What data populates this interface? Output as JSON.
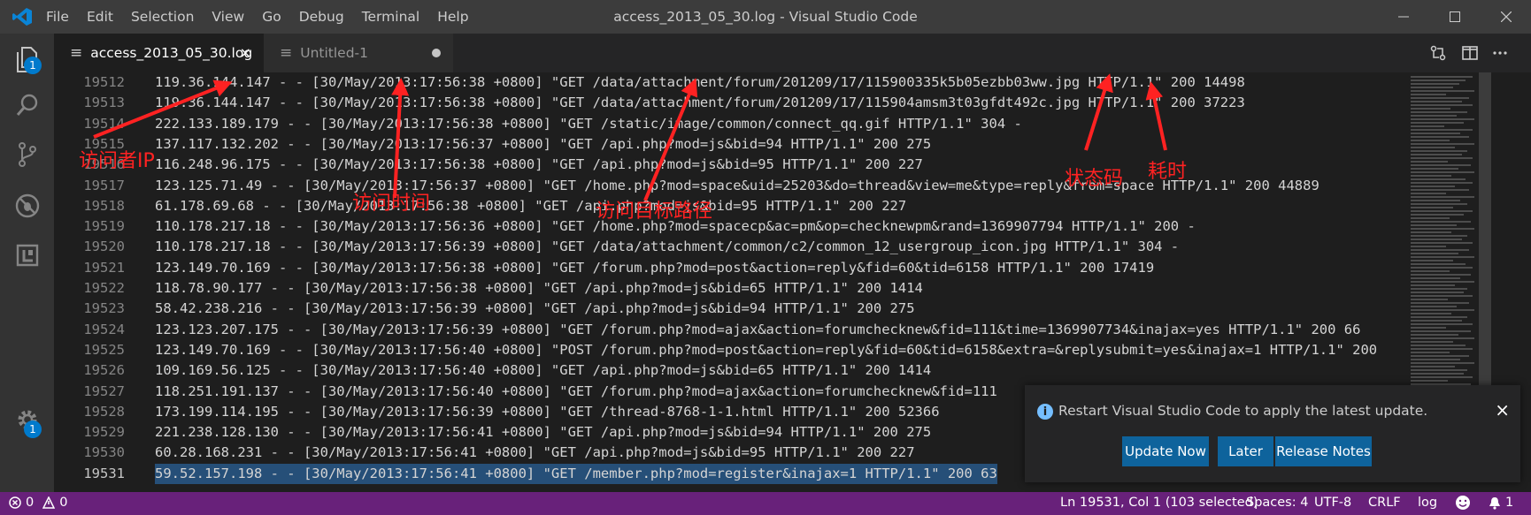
{
  "menu": [
    "File",
    "Edit",
    "Selection",
    "View",
    "Go",
    "Debug",
    "Terminal",
    "Help"
  ],
  "window_title": "access_2013_05_30.log - Visual Studio Code",
  "activity_badges": {
    "explorer": "1",
    "settings": "1"
  },
  "tabs": [
    {
      "label": "access_2013_05_30.log",
      "close": "×",
      "active": true
    },
    {
      "label": "Untitled-1",
      "dirty": true,
      "active": false
    }
  ],
  "lines": [
    {
      "num": "19512",
      "text": "119.36.144.147 - - [30/May/2013:17:56:38 +0800] \"GET /data/attachment/forum/201209/17/115900335k5b05ezbb03ww.jpg HTTP/1.1\" 200 14498"
    },
    {
      "num": "19513",
      "text": "119.36.144.147 - - [30/May/2013:17:56:38 +0800] \"GET /data/attachment/forum/201209/17/115904amsm3t03gfdt492c.jpg HTTP/1.1\" 200 37223"
    },
    {
      "num": "19514",
      "text": "222.133.189.179 - - [30/May/2013:17:56:38 +0800] \"GET /static/image/common/connect_qq.gif HTTP/1.1\" 304 -"
    },
    {
      "num": "19515",
      "text": "137.117.132.202 - - [30/May/2013:17:56:37 +0800] \"GET /api.php?mod=js&bid=94 HTTP/1.1\" 200 275"
    },
    {
      "num": "19516",
      "text": "116.248.96.175 - - [30/May/2013:17:56:38 +0800] \"GET /api.php?mod=js&bid=95 HTTP/1.1\" 200 227"
    },
    {
      "num": "19517",
      "text": "123.125.71.49 - - [30/May/2013:17:56:37 +0800] \"GET /home.php?mod=space&uid=25203&do=thread&view=me&type=reply&from=space HTTP/1.1\" 200 44889"
    },
    {
      "num": "19518",
      "text": "61.178.69.68 - - [30/May/2013:17:56:38 +0800] \"GET /api.php?mod=js&bid=95 HTTP/1.1\" 200 227"
    },
    {
      "num": "19519",
      "text": "110.178.217.18 - - [30/May/2013:17:56:36 +0800] \"GET /home.php?mod=spacecp&ac=pm&op=checknewpm&rand=1369907794 HTTP/1.1\" 200 -"
    },
    {
      "num": "19520",
      "text": "110.178.217.18 - - [30/May/2013:17:56:39 +0800] \"GET /data/attachment/common/c2/common_12_usergroup_icon.jpg HTTP/1.1\" 304 -"
    },
    {
      "num": "19521",
      "text": "123.149.70.169 - - [30/May/2013:17:56:38 +0800] \"GET /forum.php?mod=post&action=reply&fid=60&tid=6158 HTTP/1.1\" 200 17419"
    },
    {
      "num": "19522",
      "text": "118.78.90.177 - - [30/May/2013:17:56:38 +0800] \"GET /api.php?mod=js&bid=65 HTTP/1.1\" 200 1414"
    },
    {
      "num": "19523",
      "text": "58.42.238.216 - - [30/May/2013:17:56:39 +0800] \"GET /api.php?mod=js&bid=94 HTTP/1.1\" 200 275"
    },
    {
      "num": "19524",
      "text": "123.123.207.175 - - [30/May/2013:17:56:39 +0800] \"GET /forum.php?mod=ajax&action=forumchecknew&fid=111&time=1369907734&inajax=yes HTTP/1.1\" 200 66"
    },
    {
      "num": "19525",
      "text": "123.149.70.169 - - [30/May/2013:17:56:40 +0800] \"POST /forum.php?mod=post&action=reply&fid=60&tid=6158&extra=&replysubmit=yes&inajax=1 HTTP/1.1\" 200"
    },
    {
      "num": "19526",
      "text": "109.169.56.125 - - [30/May/2013:17:56:40 +0800] \"GET /api.php?mod=js&bid=65 HTTP/1.1\" 200 1414"
    },
    {
      "num": "19527",
      "text": "118.251.191.137 - - [30/May/2013:17:56:40 +0800] \"GET /forum.php?mod=ajax&action=forumchecknew&fid=111"
    },
    {
      "num": "19528",
      "text": "173.199.114.195 - - [30/May/2013:17:56:39 +0800] \"GET /thread-8768-1-1.html HTTP/1.1\" 200 52366"
    },
    {
      "num": "19529",
      "text": "221.238.128.130 - - [30/May/2013:17:56:41 +0800] \"GET /api.php?mod=js&bid=94 HTTP/1.1\" 200 275"
    },
    {
      "num": "19530",
      "text": "60.28.168.231 - - [30/May/2013:17:56:41 +0800] \"GET /api.php?mod=js&bid=95 HTTP/1.1\" 200 227"
    },
    {
      "num": "19531",
      "text": "59.52.157.198 - - [30/May/2013:17:56:41 +0800] \"GET /member.php?mod=register&inajax=1 HTTP/1.1\" 200 63",
      "selected": true
    }
  ],
  "annotations": [
    "访问者IP",
    "访问时间",
    "访问目标路径",
    "状态码",
    "耗时"
  ],
  "annotation_color": "#ff2222",
  "notification": {
    "message": "Restart Visual Studio Code to apply the latest update.",
    "close": "×",
    "buttons": [
      "Update Now",
      "Later",
      "Release Notes"
    ]
  },
  "status": {
    "errors": "0",
    "warnings": "0",
    "position": "Ln 19531, Col 1 (103 selected)",
    "spaces": "Spaces: 4",
    "encoding": "UTF-8",
    "eol": "CRLF",
    "language": "log",
    "notifications": "1"
  },
  "colors": {
    "statusbar": "#68217a",
    "selection": "#264f78",
    "accent": "#007acc",
    "button": "#0e639c"
  }
}
